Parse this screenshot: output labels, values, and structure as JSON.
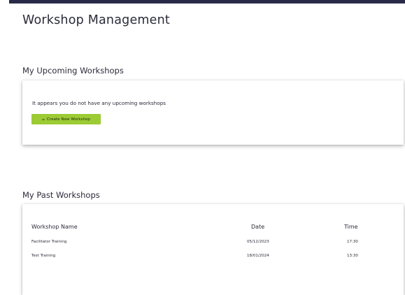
{
  "header": {
    "title": "Workshop Management"
  },
  "upcoming": {
    "heading": "My Upcoming Workshops",
    "empty_message": "It appears you do not have any upcoming workshops",
    "create_button_label": "Create New Workshop",
    "create_button_icon": "chevron-down-icon",
    "button_color": "#9ccb34"
  },
  "past": {
    "heading": "My Past Workshops",
    "columns": [
      "Workshop Name",
      "Date",
      "Time"
    ],
    "rows": [
      {
        "name": "Facilitator Training",
        "date": "05/12/2023",
        "time": "17:30"
      },
      {
        "name": "Test Training",
        "date": "18/01/2024",
        "time": "13:30"
      }
    ]
  },
  "colors": {
    "top_bar": "#2a2a48",
    "text": "#2b2b3a"
  }
}
